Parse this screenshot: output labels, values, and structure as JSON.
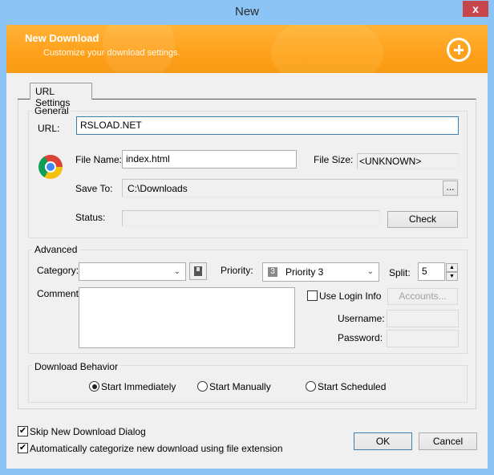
{
  "window": {
    "title": "New",
    "close_label": "x"
  },
  "banner": {
    "title": "New Download",
    "subtitle": "Customize your download settings.",
    "icon": "plus-circle-icon"
  },
  "tabs": [
    {
      "label": "URL Settings",
      "active": true
    }
  ],
  "general": {
    "group_label": "General",
    "url_label": "URL:",
    "url_value": "RSLOAD.NET",
    "file_icon": "chrome-icon",
    "file_name_label": "File Name:",
    "file_name_value": "index.html",
    "file_size_label": "File Size:",
    "file_size_value": "<UNKNOWN>",
    "save_to_label": "Save To:",
    "save_to_value": "C:\\Downloads",
    "browse_label": "...",
    "status_label": "Status:",
    "status_value": "",
    "check_label": "Check"
  },
  "advanced": {
    "group_label": "Advanced",
    "category_label": "Category:",
    "category_value": "",
    "priority_label": "Priority:",
    "priority_badge": "3",
    "priority_value": "Priority 3",
    "split_label": "Split:",
    "split_value": "5",
    "comment_label": "Comment:",
    "comment_value": "",
    "use_login_label": "Use Login Info",
    "use_login_checked": false,
    "accounts_label": "Accounts...",
    "username_label": "Username:",
    "password_label": "Password:"
  },
  "behavior": {
    "group_label": "Download Behavior",
    "options": [
      {
        "label": "Start Immediately",
        "checked": true
      },
      {
        "label": "Start Manually",
        "checked": false
      },
      {
        "label": "Start Scheduled",
        "checked": false
      }
    ]
  },
  "footer": {
    "skip_dialog_label": "Skip New Download Dialog",
    "skip_dialog_checked": true,
    "auto_categorize_label": "Automatically categorize new download using file extension",
    "auto_categorize_checked": true,
    "ok_label": "OK",
    "cancel_label": "Cancel"
  }
}
